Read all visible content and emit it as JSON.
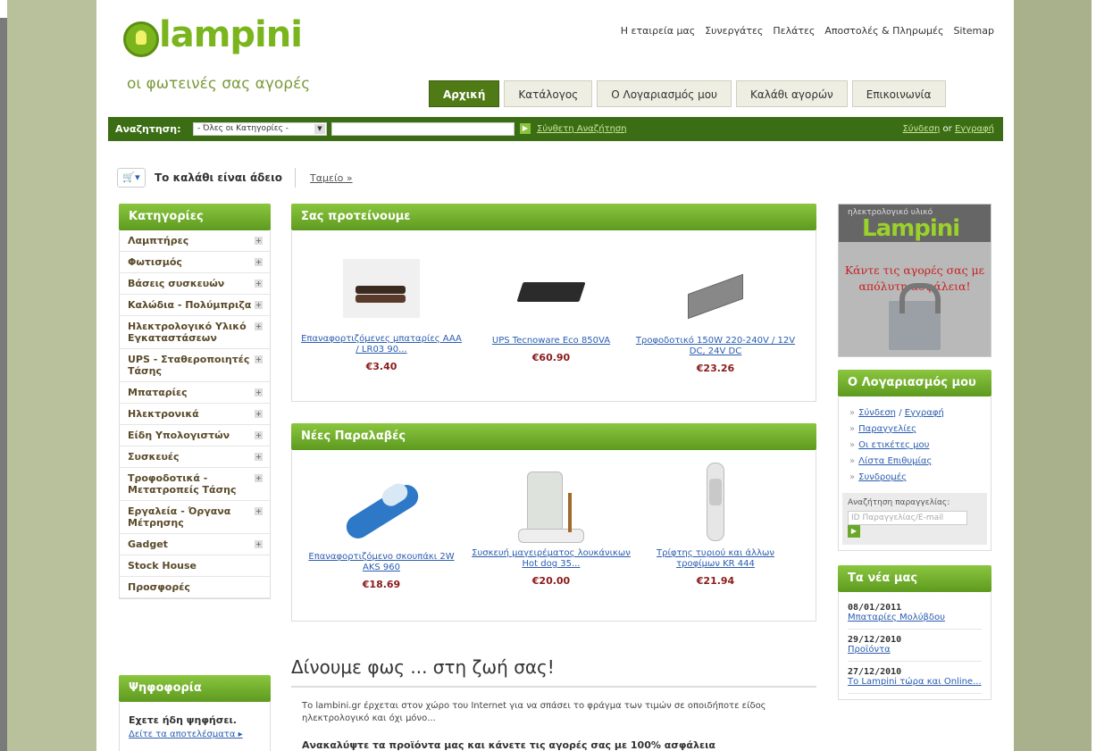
{
  "site": {
    "logo_name": "lampini",
    "tagline": "οι φωτεινές σας αγορές"
  },
  "toplinks": [
    "Η εταιρεία μας",
    "Συνεργάτες",
    "Πελάτες",
    "Αποστολές & Πληρωμές",
    "Sitemap"
  ],
  "tabs": [
    {
      "label": "Αρχική",
      "active": true
    },
    {
      "label": "Κατάλογος",
      "active": false
    },
    {
      "label": "Ο Λογαριασμός μου",
      "active": false
    },
    {
      "label": "Καλάθι αγορών",
      "active": false
    },
    {
      "label": "Επικοινωνία",
      "active": false
    }
  ],
  "search": {
    "label": "Αναζητηση:",
    "category": "- Όλες οι Κατηγορίες -",
    "advanced": "Σύνθετη Αναζήτηση",
    "login": "Σύνδεση",
    "or": "or",
    "register": "Εγγραφή"
  },
  "cart": {
    "empty": "Το καλάθι είναι άδειο",
    "checkout": "Ταμείο »"
  },
  "categories": {
    "title": "Κατηγορίες",
    "items": [
      {
        "label": "Λαμπτήρες",
        "plus": true
      },
      {
        "label": "Φωτισμός",
        "plus": true
      },
      {
        "label": "Βάσεις συσκευών",
        "plus": true
      },
      {
        "label": "Καλώδια - Πολύμπριζα",
        "plus": true
      },
      {
        "label": "Ηλεκτρολογικό Υλικό Εγκαταστάσεων",
        "plus": true
      },
      {
        "label": "UPS - Σταθεροποιητές Τάσης",
        "plus": true
      },
      {
        "label": "Μπαταρίες",
        "plus": true
      },
      {
        "label": "Ηλεκτρονικά",
        "plus": true
      },
      {
        "label": "Είδη Υπολογιστών",
        "plus": true
      },
      {
        "label": "Συσκευές",
        "plus": true
      },
      {
        "label": "Τροφοδοτικά - Μετατροπείς Τάσης",
        "plus": true
      },
      {
        "label": "Εργαλεία - Όργανα Μέτρησης",
        "plus": true
      },
      {
        "label": "Gadget",
        "plus": true
      },
      {
        "label": "Stock House",
        "plus": false
      },
      {
        "label": "Προσφορές",
        "plus": false
      }
    ]
  },
  "vote": {
    "title": "Ψηφοφορία",
    "voted": "Εχετε ήδη ψηφήσει.",
    "results": "Δείτε τα αποτελέσματα ▸"
  },
  "featured": {
    "title": "Σας προτείνουμε",
    "products": [
      {
        "name": "Επαναφορτιζόμενες μπαταρίες AAA / LR03 90...",
        "price": "€3.40",
        "icon": "batteries-image"
      },
      {
        "name": "UPS Tecnoware Eco 850VA",
        "price": "€60.90",
        "icon": "ups-image"
      },
      {
        "name": "Τροφοδοτικό 150W 220-240V / 12V DC, 24V DC",
        "price": "€23.26",
        "icon": "power-supply-image"
      }
    ]
  },
  "new_arrivals": {
    "title": "Νέες Παραλαβές",
    "products": [
      {
        "name": "Επαναφορτιζόμενο σκουπάκι 2W AKS 960",
        "price": "€18.69",
        "icon": "hand-vacuum-image"
      },
      {
        "name": "Συσκευή μαγειρέματος λουκάνικων Hot dog 35...",
        "price": "€20.00",
        "icon": "hot-dog-maker-image"
      },
      {
        "name": "Τρίφτης τυριού και άλλων τροφίμων KR 444",
        "price": "€21.94",
        "icon": "cheese-grater-image"
      }
    ]
  },
  "welcome": {
    "title": "Δίνουμε φως ... στη ζωή σας!",
    "text": "Το lambini.gr έρχεται στον χώρο του Internet για να σπάσει το φράγμα των τιμών σε οποιδήποτε είδος ηλεκτρολογικό και όχι μόνο...",
    "text2": "Ανακαλύψτε τα προϊόντα μας και κάνετε τις αγορές σας με 100% ασφάλεια"
  },
  "ad": {
    "small": "ηλεκτρολογικό υλικό",
    "brand": "Lampini",
    "slogan": "Κάντε τις αγορές σας με απόλυτη ασφάλεια!"
  },
  "account": {
    "title": "Ο Λογαριασμός μου",
    "login": "Σύνδεση",
    "register": "Εγγραφή",
    "items": [
      "Παραγγελίες",
      "Οι ετικέτες μου",
      "Λίστα Επιθυμίας",
      "Συνδρομές"
    ],
    "order_search_label": "Αναζήτηση παραγγελίας:",
    "order_search_placeholder": "ID Παραγγελίας/E-mail"
  },
  "news": {
    "title": "Τα νέα μας",
    "items": [
      {
        "date": "08/01/2011",
        "title": "Μπαταρίες Μολύβδου"
      },
      {
        "date": "29/12/2010",
        "title": "Προϊόντα"
      },
      {
        "date": "27/12/2010",
        "title": "Το Lampini τώρα και Online..."
      }
    ]
  },
  "colors": {
    "brand_green": "#7ab51d",
    "bar_green": "#3b6e14",
    "price_red": "#8b1a1a",
    "link_blue": "#2a5db0"
  }
}
